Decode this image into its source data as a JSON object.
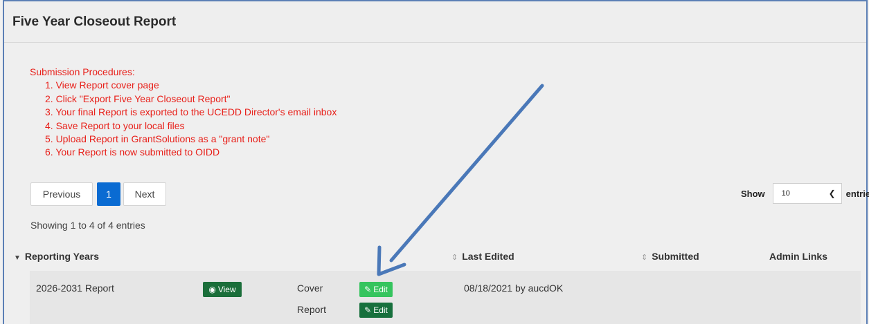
{
  "page": {
    "title": "Five Year Closeout Report"
  },
  "procedures": {
    "heading": "Submission Procedures:",
    "steps": [
      "1. View Report cover page",
      "2. Click \"Export Five Year Closeout Report\"",
      "3. Your final Report is exported to the UCEDD Director's email inbox",
      "4. Save Report to your local files",
      "5. Upload Report in GrantSolutions as a \"grant note\"",
      "6. Your Report is now submitted to OIDD"
    ]
  },
  "pagination": {
    "previous_label": "Previous",
    "current_page": "1",
    "next_label": "Next"
  },
  "length_menu": {
    "show_label": "Show",
    "selected": "10",
    "entries_label": "entries"
  },
  "info_text": "Showing 1 to 4 of 4 entries",
  "table": {
    "headers": {
      "reporting_years": "Reporting Years",
      "last_edited": "Last Edited",
      "submitted": "Submitted",
      "admin_links": "Admin Links"
    },
    "rows": [
      {
        "name": "2026-2031 Report",
        "view_label": "View",
        "cover_label": "Cover",
        "report_label": "Report",
        "edit_label": "Edit",
        "last_edited": "08/18/2021 by aucdOK",
        "submitted": ""
      }
    ]
  },
  "colors": {
    "procedures_text": "#e8201a",
    "page_active": "#0a6bd2",
    "view_button": "#1b6e3a",
    "edit_cover_button": "#35c45e",
    "edit_report_button": "#17703d",
    "annotation_arrow": "#4a78b8"
  },
  "icons": {
    "sort": "sort-icon",
    "view": "binoculars-icon",
    "edit": "pencil-icon",
    "select": "chevron-down-icon",
    "expand": "caret-down-icon"
  }
}
